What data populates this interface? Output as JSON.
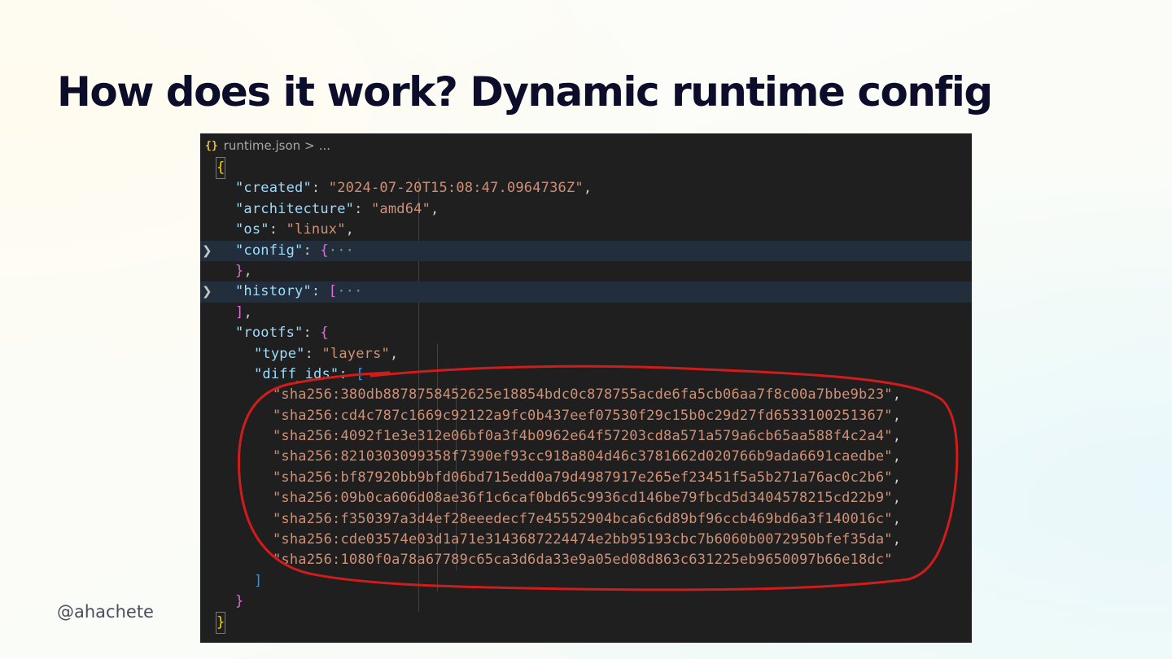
{
  "slide": {
    "title": "How does it work? Dynamic runtime config",
    "author": "@ahachete"
  },
  "editor": {
    "breadcrumb": {
      "icon": "{}",
      "file": "runtime.json",
      "separator": ">",
      "more": "..."
    },
    "json": {
      "open_brace": "{",
      "close_brace": "}",
      "created_key": "\"created\"",
      "created_value": "\"2024-07-20T15:08:47.0964736Z\"",
      "architecture_key": "\"architecture\"",
      "architecture_value": "\"amd64\"",
      "os_key": "\"os\"",
      "os_value": "\"linux\"",
      "config_key": "\"config\"",
      "config_open": "{",
      "config_close": "}",
      "history_key": "\"history\"",
      "history_open": "[",
      "history_close": "]",
      "folded_ellipsis": "···",
      "rootfs_key": "\"rootfs\"",
      "rootfs_open": "{",
      "rootfs_close": "}",
      "type_key": "\"type\"",
      "type_value": "\"layers\"",
      "diff_ids_key": "\"diff_ids\"",
      "diff_ids_open": "[",
      "diff_ids_close": "]",
      "diff_ids": [
        "\"sha256:380db8878758452625e18854bdc0c878755acde6fa5cb06aa7f8c00a7bbe9b23\"",
        "\"sha256:cd4c787c1669c92122a9fc0b437eef07530f29c15b0c29d27fd6533100251367\"",
        "\"sha256:4092f1e3e312e06bf0a3f4b0962e64f57203cd8a571a579a6cb65aa588f4c2a4\"",
        "\"sha256:8210303099358f7390ef93cc918a804d46c3781662d020766b9ada6691caedbe\"",
        "\"sha256:bf87920bb9bfd06bd715edd0a79d4987917e265ef23451f5a5b271a76ac0c2b6\"",
        "\"sha256:09b0ca606d08ae36f1c6caf0bd65c9936cd146be79fbcd5d3404578215cd22b9\"",
        "\"sha256:f350397a3d4ef28eeedecf7e45552904bca6c6d89bf96ccb469bd6a3f140016c\"",
        "\"sha256:cde03574e03d1a71e3143687224474e2bb95193cbc7b6060b0072950bfef35da\"",
        "\"sha256:1080f0a78a67789c65ca3d6da33e9a05ed08d863c631225eb9650097b66e18dc\""
      ]
    }
  },
  "colors": {
    "title": "#0b0d2a",
    "editor_background": "#1f1f1f",
    "folded_line_highlight": "#222e3b",
    "json_key": "#9cdcfe",
    "json_string": "#ce9178",
    "bracket_level1": "#ffd700",
    "bracket_level2": "#da70d6",
    "bracket_level3": "#179fff",
    "annotation_circle": "#d11c1c"
  },
  "icons": {
    "breadcrumb": "json-braces-icon",
    "fold": "chevron-right-icon"
  }
}
